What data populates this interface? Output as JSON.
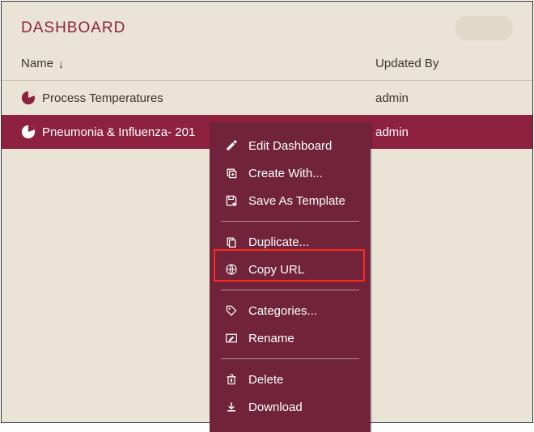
{
  "colors": {
    "accent": "#8e2040",
    "menu_bg": "#70233a",
    "bg": "#eae4d7"
  },
  "header": {
    "title": "DASHBOARD"
  },
  "columns": {
    "name": "Name",
    "updated_by": "Updated By",
    "sort_arrow": "↓"
  },
  "rows": [
    {
      "label": "Process Temperatures",
      "updated_by": "admin"
    },
    {
      "label": "Pneumonia & Influenza- 201",
      "updated_by": "admin"
    }
  ],
  "context_menu": {
    "groups": [
      [
        {
          "icon": "pencil-icon",
          "label": "Edit Dashboard"
        },
        {
          "icon": "copy-plus-icon",
          "label": "Create With..."
        },
        {
          "icon": "save-star-icon",
          "label": "Save As Template"
        }
      ],
      [
        {
          "icon": "duplicate-icon",
          "label": "Duplicate..."
        },
        {
          "icon": "globe-icon",
          "label": "Copy URL"
        }
      ],
      [
        {
          "icon": "tag-icon",
          "label": "Categories..."
        },
        {
          "icon": "rename-icon",
          "label": "Rename"
        }
      ],
      [
        {
          "icon": "trash-icon",
          "label": "Delete"
        },
        {
          "icon": "download-icon",
          "label": "Download"
        }
      ]
    ]
  }
}
